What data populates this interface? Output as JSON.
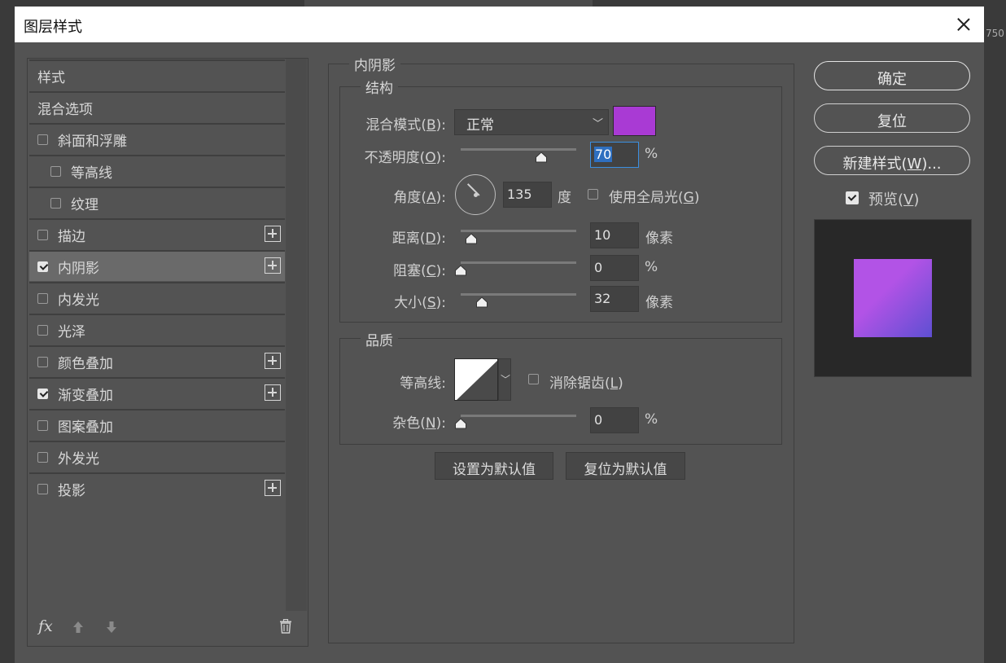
{
  "dialog": {
    "title": "图层样式"
  },
  "style_list": {
    "items": [
      {
        "label": "样式",
        "has_checkbox": false,
        "checked": false,
        "plus": false,
        "indent": 0,
        "active": false
      },
      {
        "label": "混合选项",
        "has_checkbox": false,
        "checked": false,
        "plus": false,
        "indent": 0,
        "active": false
      },
      {
        "label": "斜面和浮雕",
        "has_checkbox": true,
        "checked": false,
        "plus": false,
        "indent": 0,
        "active": false
      },
      {
        "label": "等高线",
        "has_checkbox": true,
        "checked": false,
        "plus": false,
        "indent": 1,
        "active": false
      },
      {
        "label": "纹理",
        "has_checkbox": true,
        "checked": false,
        "plus": false,
        "indent": 1,
        "active": false
      },
      {
        "label": "描边",
        "has_checkbox": true,
        "checked": false,
        "plus": true,
        "indent": 0,
        "active": false
      },
      {
        "label": "内阴影",
        "has_checkbox": true,
        "checked": true,
        "plus": true,
        "indent": 0,
        "active": true
      },
      {
        "label": "内发光",
        "has_checkbox": true,
        "checked": false,
        "plus": false,
        "indent": 0,
        "active": false
      },
      {
        "label": "光泽",
        "has_checkbox": true,
        "checked": false,
        "plus": false,
        "indent": 0,
        "active": false
      },
      {
        "label": "颜色叠加",
        "has_checkbox": true,
        "checked": false,
        "plus": true,
        "indent": 0,
        "active": false
      },
      {
        "label": "渐变叠加",
        "has_checkbox": true,
        "checked": true,
        "plus": true,
        "indent": 0,
        "active": false
      },
      {
        "label": "图案叠加",
        "has_checkbox": true,
        "checked": false,
        "plus": false,
        "indent": 0,
        "active": false
      },
      {
        "label": "外发光",
        "has_checkbox": true,
        "checked": false,
        "plus": false,
        "indent": 0,
        "active": false
      },
      {
        "label": "投影",
        "has_checkbox": true,
        "checked": false,
        "plus": true,
        "indent": 0,
        "active": false
      }
    ],
    "fx_label": "fx"
  },
  "inner_shadow": {
    "section_title": "内阴影",
    "structure_title": "结构",
    "quality_title": "品质",
    "blend_mode": {
      "label": "混合模式",
      "hotkey": "B",
      "value": "正常",
      "color": "#a93ad4"
    },
    "opacity": {
      "label": "不透明度",
      "hotkey": "O",
      "value": "70",
      "unit": "%",
      "fraction": 0.7
    },
    "angle": {
      "label": "角度",
      "hotkey": "A",
      "value": "135",
      "unit": "度",
      "global_light_label": "使用全局光",
      "global_light_hotkey": "G",
      "global_light_checked": false
    },
    "distance": {
      "label": "距离",
      "hotkey": "D",
      "value": "10",
      "unit": "像素",
      "fraction": 0.09
    },
    "choke": {
      "label": "阻塞",
      "hotkey": "C",
      "value": "0",
      "unit": "%",
      "fraction": 0.0
    },
    "size": {
      "label": "大小",
      "hotkey": "S",
      "value": "32",
      "unit": "像素",
      "fraction": 0.18
    },
    "contour": {
      "label": "等高线",
      "antialias_label": "消除锯齿",
      "antialias_hotkey": "L",
      "antialias_checked": false
    },
    "noise": {
      "label": "杂色",
      "hotkey": "N",
      "value": "0",
      "unit": "%",
      "fraction": 0.0
    },
    "set_default_label": "设置为默认值",
    "reset_default_label": "复位为默认值"
  },
  "actions": {
    "ok_label": "确定",
    "reset_label": "复位",
    "new_style_label": "新建样式",
    "new_style_hotkey": "W",
    "preview_label": "预览",
    "preview_hotkey": "V",
    "preview_checked": true
  },
  "background": {
    "ruler_number": "750"
  },
  "colors": {
    "preview_top": "#b253e6",
    "preview_bottom": "#5e4fd2"
  }
}
